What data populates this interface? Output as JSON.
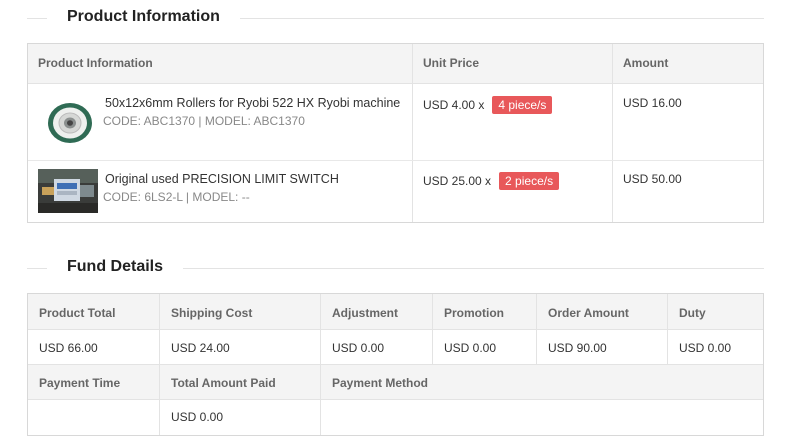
{
  "product_section": {
    "title": "Product Information",
    "headers": {
      "product": "Product Information",
      "unit_price": "Unit Price",
      "amount": "Amount"
    },
    "items": [
      {
        "name": "50x12x6mm Rollers for Ryobi 522 HX Ryobi machine",
        "meta": "CODE: ABC1370 | MODEL: ABC1370",
        "unit_price": "USD 4.00 x",
        "qty": "4 piece/s",
        "amount": "USD 16.00",
        "thumb_icon": "roller-wheel-icon"
      },
      {
        "name": "Original used PRECISION LIMIT SWITCH",
        "meta": "CODE: 6LS2-L | MODEL: --",
        "unit_price": "USD 25.00 x",
        "qty": "2 piece/s",
        "amount": "USD 50.00",
        "thumb_icon": "limit-switch-icon"
      }
    ]
  },
  "fund_section": {
    "title": "Fund Details",
    "row1_headers": [
      "Product Total",
      "Shipping Cost",
      "Adjustment",
      "Promotion",
      "Order Amount",
      "Duty"
    ],
    "row1_values": [
      "USD 66.00",
      "USD 24.00",
      "USD 0.00",
      "USD 0.00",
      "USD 90.00",
      "USD 0.00"
    ],
    "row2_headers": [
      "Payment Time",
      "Total Amount Paid",
      "Payment Method"
    ],
    "row2_values": [
      "",
      "USD 0.00",
      ""
    ]
  },
  "colors": {
    "badge": "#e8585a",
    "header_bg": "#f4f4f4",
    "border": "#d8d8d8"
  }
}
